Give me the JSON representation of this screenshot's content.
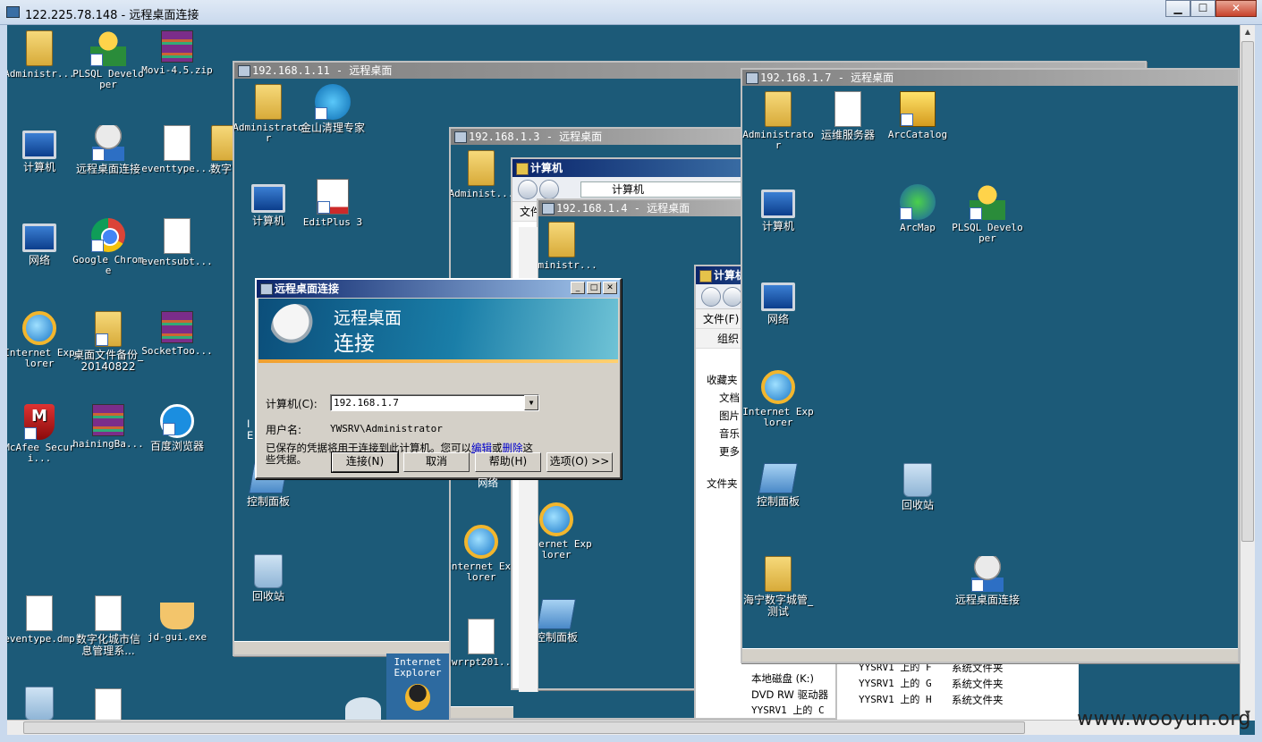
{
  "outer": {
    "title": "122.225.78.148 - 远程桌面连接",
    "controls": {
      "minimize": "▁",
      "maximize": "☐",
      "close": "✕"
    }
  },
  "desktop_icons": [
    {
      "name": "Administr...",
      "icon": "folder-icon"
    },
    {
      "name": "PLSQL Developer",
      "icon": "plsql-icon"
    },
    {
      "name": "Movi-4.5.zip",
      "icon": "winrar-icon"
    },
    {
      "name": "计算机",
      "icon": "computer-icon"
    },
    {
      "name": "远程桌面连接",
      "icon": "rdp-icon"
    },
    {
      "name": "eventtype...",
      "icon": "document-icon"
    },
    {
      "name": "数字",
      "icon": "folder-icon"
    },
    {
      "name": "网络",
      "icon": "network-icon"
    },
    {
      "name": "Google Chrome",
      "icon": "chrome-icon"
    },
    {
      "name": "eventsubt...",
      "icon": "document-icon"
    },
    {
      "name": "Internet Explorer",
      "icon": "ie-icon"
    },
    {
      "name": "桌面文件备份_20140822",
      "icon": "folder-icon"
    },
    {
      "name": "SocketToo...",
      "icon": "winrar-icon"
    },
    {
      "name": "McAfee Securi...",
      "icon": "mcafee-icon"
    },
    {
      "name": "hainingBa...",
      "icon": "winrar-icon"
    },
    {
      "name": "百度浏览器",
      "icon": "baidu-browser-icon"
    },
    {
      "name": "eventype.dmp",
      "icon": "document-icon"
    },
    {
      "name": "数字化城市信息管理系...",
      "icon": "ie-document-icon"
    },
    {
      "name": "jd-gui.exe",
      "icon": "coffee-icon"
    }
  ],
  "win11": {
    "title": "192.168.1.11 - 远程桌面",
    "icons": [
      {
        "name": "Administrator"
      },
      {
        "name": "金山清理专家"
      },
      {
        "name": "计算机"
      },
      {
        "name": "EditPlus 3"
      },
      {
        "name": "控制面板"
      },
      {
        "name": "回收站"
      }
    ]
  },
  "win3": {
    "title": "192.168.1.3 - 远程桌面",
    "icons": [
      {
        "name": "Administ..."
      },
      {
        "name": "网络"
      },
      {
        "name": "Internet Explorer"
      },
      {
        "name": "awrrpt201..."
      }
    ]
  },
  "explorer_a": {
    "title": "计算机",
    "address": "计算机",
    "menu": "文件"
  },
  "win4": {
    "title": "192.168.1.4 - 远程桌面",
    "icons": [
      {
        "name": "Administr..."
      },
      {
        "name": "Internet Explorer"
      },
      {
        "name": "控制面板"
      }
    ]
  },
  "explorer_b": {
    "title": "计算机",
    "menu": "文件(F)",
    "organize": "组织",
    "favorites": "收藏夹",
    "sidebar": [
      "文档",
      "图片",
      "音乐",
      "更多"
    ],
    "folders_label": "文件夹",
    "drives": [
      "本地磁盘 (K:)",
      "DVD RW 驱动器",
      "YYSRV1 上的 C"
    ],
    "shares": [
      {
        "name": "YYSRV1 上的 F",
        "type": "系统文件夹"
      },
      {
        "name": "YYSRV1 上的 G",
        "type": "系统文件夹"
      },
      {
        "name": "YYSRV1 上的 H",
        "type": "系统文件夹"
      }
    ]
  },
  "win7": {
    "title": "192.168.1.7 - 远程桌面",
    "icons": [
      {
        "name": "Administrator"
      },
      {
        "name": "运维服务器"
      },
      {
        "name": "ArcCatalog"
      },
      {
        "name": "计算机"
      },
      {
        "name": "ArcMap"
      },
      {
        "name": "PLSQL Developer"
      },
      {
        "name": "网络"
      },
      {
        "name": "Internet Explorer"
      },
      {
        "name": "控制面板"
      },
      {
        "name": "回收站"
      },
      {
        "name": "海宁数字城管_测试"
      },
      {
        "name": "远程桌面连接"
      }
    ]
  },
  "dialog": {
    "title": "远程桌面连接",
    "banner_line1": "远程桌面",
    "banner_line2": "连接",
    "computer_label": "计算机(C):",
    "computer_value": "192.168.1.7",
    "username_label": "用户名:",
    "username_value": "YWSRV\\Administrator",
    "note_prefix": "已保存的凭据将用于连接到此计算机。您可以",
    "note_edit": "编辑",
    "note_or": "或",
    "note_delete": "删除",
    "note_suffix": "这些凭据。",
    "buttons": {
      "connect": "连接(N)",
      "cancel": "取消",
      "help": "帮助(H)",
      "options": "选项(O) >>"
    }
  },
  "partial_labels": {
    "internet_explorer": "Internet Explorer",
    "network": "网络",
    "left_i": "I",
    "left_e": "E"
  },
  "watermark": "www.wooyun.org"
}
